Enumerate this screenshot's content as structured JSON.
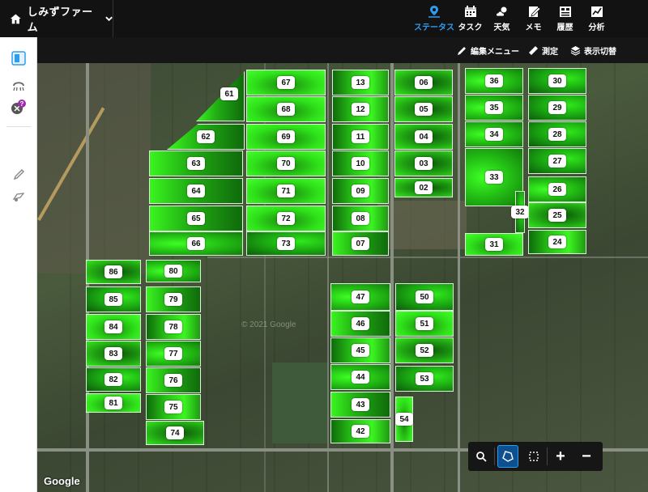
{
  "app": {
    "farm_name": "しみずファーム"
  },
  "nav": [
    {
      "key": "status",
      "label": "ステータス",
      "icon": "map-pin-icon",
      "active": true
    },
    {
      "key": "task",
      "label": "タスク",
      "icon": "calendar-icon",
      "active": false
    },
    {
      "key": "weather",
      "label": "天気",
      "icon": "weather-icon",
      "active": false
    },
    {
      "key": "memo",
      "label": "メモ",
      "icon": "memo-icon",
      "active": false
    },
    {
      "key": "history",
      "label": "履歴",
      "icon": "history-icon",
      "active": false
    },
    {
      "key": "analysis",
      "label": "分析",
      "icon": "analysis-icon",
      "active": false
    }
  ],
  "subtoolbar": {
    "edit_menu": "編集メニュー",
    "measure": "測定",
    "display_toggle": "表示切替"
  },
  "map": {
    "attribution": "Google",
    "copyright": "© 2021 Google"
  },
  "fields": [
    "67",
    "13",
    "06",
    "36",
    "30",
    "61",
    "68",
    "12",
    "05",
    "35",
    "29",
    "62",
    "69",
    "11",
    "04",
    "34",
    "28",
    "63",
    "70",
    "10",
    "03",
    "33",
    "27",
    "64",
    "71",
    "09",
    "02",
    "26",
    "32",
    "65",
    "72",
    "08",
    "25",
    "66",
    "73",
    "07",
    "31",
    "24",
    "86",
    "80",
    "85",
    "79",
    "84",
    "78",
    "83",
    "77",
    "82",
    "76",
    "81",
    "75",
    "74",
    "47",
    "50",
    "46",
    "51",
    "45",
    "52",
    "44",
    "53",
    "43",
    "54",
    "42"
  ],
  "colors": {
    "accent": "#2d9df0",
    "header_bg": "#121212",
    "toolbar_bg": "#161616",
    "field_border": "#ffffff"
  }
}
